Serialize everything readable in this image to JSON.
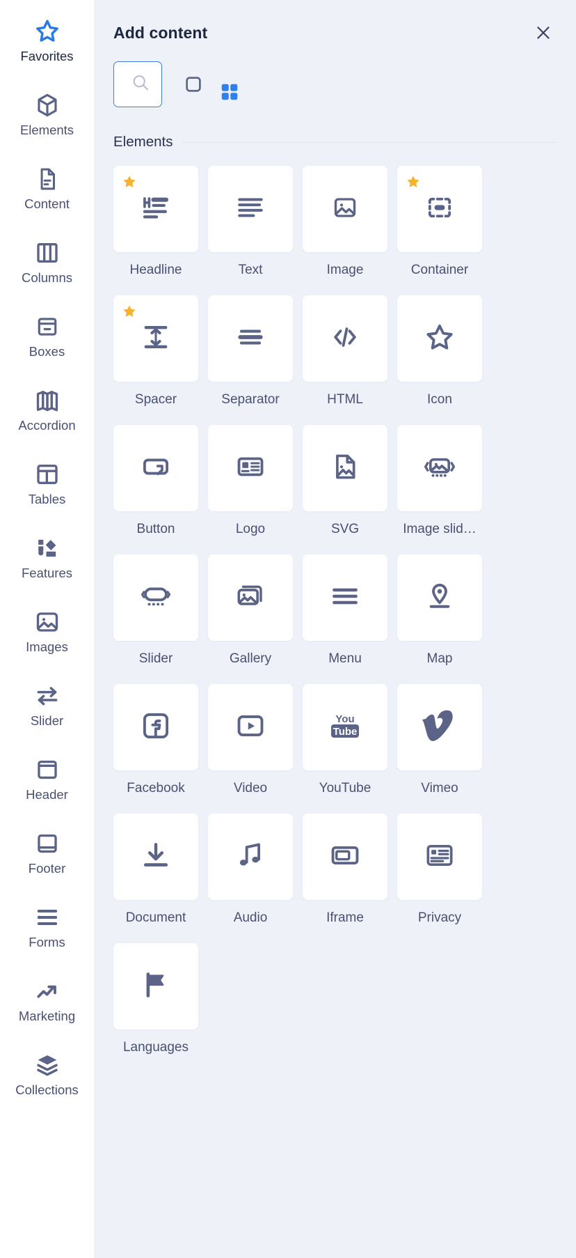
{
  "sidebar": {
    "items": [
      {
        "label": "Favorites",
        "icon": "star-icon",
        "active": true
      },
      {
        "label": "Elements",
        "icon": "cube-icon",
        "active": false
      },
      {
        "label": "Content",
        "icon": "document-icon",
        "active": false
      },
      {
        "label": "Columns",
        "icon": "columns-icon",
        "active": false
      },
      {
        "label": "Boxes",
        "icon": "box-icon",
        "active": false
      },
      {
        "label": "Accordion",
        "icon": "accordion-icon",
        "active": false
      },
      {
        "label": "Tables",
        "icon": "table-icon",
        "active": false
      },
      {
        "label": "Features",
        "icon": "features-icon",
        "active": false
      },
      {
        "label": "Images",
        "icon": "image-icon",
        "active": false
      },
      {
        "label": "Slider",
        "icon": "arrows-icon",
        "active": false
      },
      {
        "label": "Header",
        "icon": "header-icon",
        "active": false
      },
      {
        "label": "Footer",
        "icon": "footer-icon",
        "active": false
      },
      {
        "label": "Forms",
        "icon": "forms-icon",
        "active": false
      },
      {
        "label": "Marketing",
        "icon": "trend-up-icon",
        "active": false
      },
      {
        "label": "Collections",
        "icon": "layers-icon",
        "active": false
      }
    ]
  },
  "header": {
    "title": "Add content",
    "close_label": "close-icon"
  },
  "search": {
    "value": "Search",
    "placeholder": "Search"
  },
  "view_toggle": {
    "list_label": "list-view",
    "grid_label": "grid-view",
    "active": "grid",
    "active_color": "#2f7ff0",
    "inactive_color": "#5b6387"
  },
  "section": {
    "title": "Elements"
  },
  "colors": {
    "accent": "#2c7be5",
    "star": "#f5b22d",
    "icon": "#5b6387",
    "panel_bg": "#eef1f8",
    "tile_bg": "#ffffff"
  },
  "elements": [
    {
      "label": "Headline",
      "icon": "headline-icon",
      "favorite": true
    },
    {
      "label": "Text",
      "icon": "text-icon",
      "favorite": false
    },
    {
      "label": "Image",
      "icon": "image-icon",
      "favorite": false
    },
    {
      "label": "Container",
      "icon": "container-icon",
      "favorite": true
    },
    {
      "label": "Spacer",
      "icon": "spacer-icon",
      "favorite": true
    },
    {
      "label": "Separator",
      "icon": "separator-icon",
      "favorite": false
    },
    {
      "label": "HTML",
      "icon": "code-icon",
      "favorite": false
    },
    {
      "label": "Icon",
      "icon": "star-outline-icon",
      "favorite": false
    },
    {
      "label": "Button",
      "icon": "button-icon",
      "favorite": false
    },
    {
      "label": "Logo",
      "icon": "logo-icon",
      "favorite": false
    },
    {
      "label": "SVG",
      "icon": "svg-file-icon",
      "favorite": false
    },
    {
      "label": "Image slid…",
      "icon": "image-slider-icon",
      "favorite": false
    },
    {
      "label": "Slider",
      "icon": "slider-icon",
      "favorite": false
    },
    {
      "label": "Gallery",
      "icon": "gallery-icon",
      "favorite": false
    },
    {
      "label": "Menu",
      "icon": "menu-icon",
      "favorite": false
    },
    {
      "label": "Map",
      "icon": "map-pin-icon",
      "favorite": false
    },
    {
      "label": "Facebook",
      "icon": "facebook-icon",
      "favorite": false
    },
    {
      "label": "Video",
      "icon": "video-icon",
      "favorite": false
    },
    {
      "label": "YouTube",
      "icon": "youtube-icon",
      "favorite": false
    },
    {
      "label": "Vimeo",
      "icon": "vimeo-icon",
      "favorite": false
    },
    {
      "label": "Document",
      "icon": "download-icon",
      "favorite": false
    },
    {
      "label": "Audio",
      "icon": "music-note-icon",
      "favorite": false
    },
    {
      "label": "Iframe",
      "icon": "iframe-icon",
      "favorite": false
    },
    {
      "label": "Privacy",
      "icon": "privacy-icon",
      "favorite": false
    },
    {
      "label": "Languages",
      "icon": "flag-icon",
      "favorite": false
    }
  ]
}
